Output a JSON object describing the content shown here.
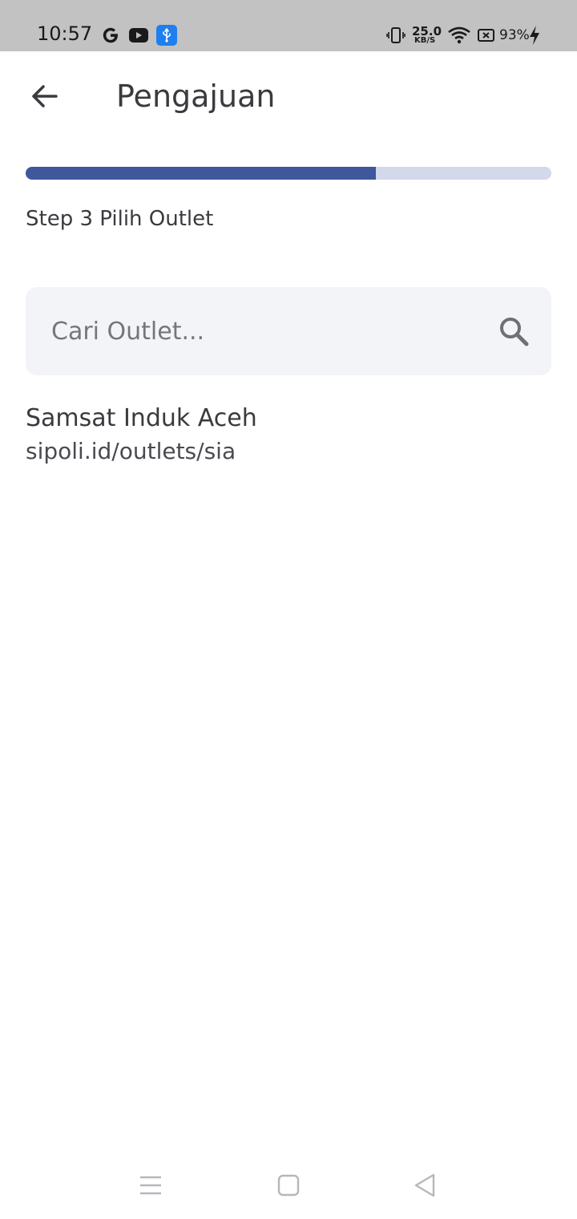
{
  "status_bar": {
    "time": "10:57",
    "net_speed_value": "25.0",
    "net_speed_unit": "KB/S",
    "battery_percent": "93%",
    "icons": [
      "google-icon",
      "youtube-icon",
      "usb-icon",
      "vibrate-icon",
      "wifi-icon",
      "battery-saver-icon",
      "charging-icon"
    ]
  },
  "header": {
    "title": "Pengajuan",
    "back_icon": "arrow-left-icon"
  },
  "progress": {
    "current_step": 3,
    "fraction": 0.666,
    "track_color": "#d3d8ea",
    "fill_color": "#3f579b"
  },
  "step": {
    "label": "Step 3 Pilih Outlet"
  },
  "search": {
    "value": "",
    "placeholder": "Cari Outlet...",
    "icon": "search-icon"
  },
  "outlets": [
    {
      "name": "Samsat Induk Aceh",
      "url": "sipoli.id/outlets/sia"
    }
  ],
  "nav_bar": {
    "buttons": [
      "menu-icon",
      "home-icon",
      "back-triangle-icon"
    ]
  }
}
